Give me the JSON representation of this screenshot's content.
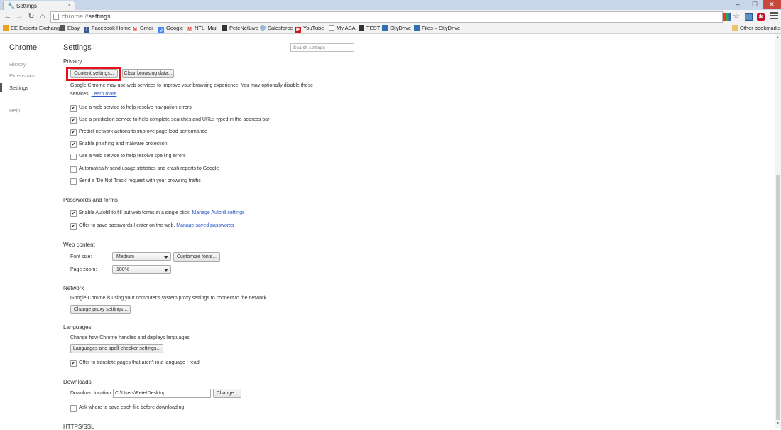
{
  "window": {
    "tab_title": "Settings",
    "tab_close": "×",
    "minimize": "–",
    "maximize": "☐",
    "close": "✕"
  },
  "toolbar": {
    "url_scheme": "chrome://",
    "url_path": "settings"
  },
  "bookmarks": {
    "items": [
      {
        "label": "EE Experts-Exchange",
        "icon": "ee-icon",
        "color": "#f09e1c"
      },
      {
        "label": "Ebay",
        "icon": "ebay-icon",
        "color": "#555555"
      },
      {
        "label": "Facebook Home",
        "icon": "facebook-icon",
        "color": "#3b5998"
      },
      {
        "label": "Gmail",
        "icon": "gmail-icon",
        "color": "#d93025"
      },
      {
        "label": "Google",
        "icon": "google-icon",
        "color": "#4285f4"
      },
      {
        "label": "NTL_Mail",
        "icon": "gmail-icon",
        "color": "#d93025"
      },
      {
        "label": "PeteNetLive",
        "icon": "pnl-icon",
        "color": "#333333"
      },
      {
        "label": "Salesforce",
        "icon": "cloud-icon",
        "color": "#9bb7d4"
      },
      {
        "label": "YouTube",
        "icon": "youtube-icon",
        "color": "#cc181e"
      },
      {
        "label": "My ASA",
        "icon": "page-icon",
        "color": "#ffffff"
      },
      {
        "label": "TEST",
        "icon": "test-icon",
        "color": "#333333"
      },
      {
        "label": "SkyDrive",
        "icon": "skydrive-icon",
        "color": "#2f6fb2"
      },
      {
        "label": "Files – SkyDrive",
        "icon": "skydrive-icon",
        "color": "#2f6fb2"
      }
    ],
    "other": "Other bookmarks"
  },
  "sidebar": {
    "title": "Chrome",
    "items": [
      {
        "label": "History"
      },
      {
        "label": "Extensions"
      },
      {
        "label": "Settings"
      },
      {
        "label": "Help"
      }
    ]
  },
  "main": {
    "title": "Settings",
    "search_placeholder": "Search settings",
    "privacy": {
      "title": "Privacy",
      "content_settings": "Content settings...",
      "clear_browsing": "Clear browsing data...",
      "desc_line1": "Google Chrome may use web services to improve your browsing experience. You may optionally disable these",
      "desc_line2": "services.",
      "learn_more": "Learn more",
      "options": [
        {
          "label": "Use a web service to help resolve navigation errors",
          "checked": true
        },
        {
          "label": "Use a prediction service to help complete searches and URLs typed in the address bar",
          "checked": true
        },
        {
          "label": "Predict network actions to improve page load performance",
          "checked": true
        },
        {
          "label": "Enable phishing and malware protection",
          "checked": true
        },
        {
          "label": "Use a web service to help resolve spelling errors",
          "checked": false
        },
        {
          "label": "Automatically send usage statistics and crash reports to Google",
          "checked": false
        },
        {
          "label": "Send a 'Do Not Track' request with your browsing traffic",
          "checked": false
        }
      ]
    },
    "passwords": {
      "title": "Passwords and forms",
      "autofill_label": "Enable Autofill to fill out web forms in a single click.",
      "autofill_link": "Manage Autofill settings",
      "save_label": "Offer to save passwords I enter on the web.",
      "save_link": "Manage saved passwords"
    },
    "web_content": {
      "title": "Web content",
      "font_size_label": "Font size:",
      "font_size_value": "Medium",
      "customize_fonts": "Customize fonts...",
      "page_zoom_label": "Page zoom:",
      "page_zoom_value": "100%"
    },
    "network": {
      "title": "Network",
      "desc": "Google Chrome is using your computer's system proxy settings to connect to the network.",
      "change_proxy": "Change proxy settings..."
    },
    "languages": {
      "title": "Languages",
      "desc": "Change how Chrome handles and displays languages",
      "button": "Languages and spell-checker settings...",
      "translate_label": "Offer to translate pages that aren't in a language I read"
    },
    "downloads": {
      "title": "Downloads",
      "location_label": "Download location:",
      "location_value": "C:\\Users\\Pete\\Desktop",
      "change": "Change...",
      "ask_label": "Ask where to save each file before downloading"
    },
    "next_section": "HTTPS/SSL"
  }
}
